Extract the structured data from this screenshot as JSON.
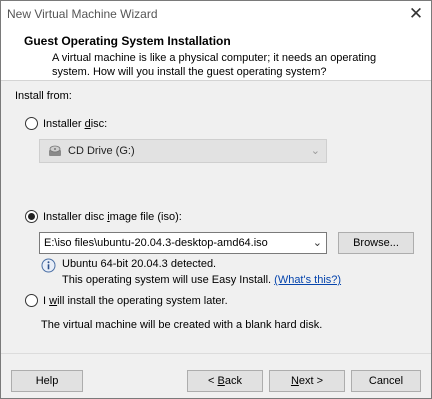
{
  "window": {
    "title": "New Virtual Machine Wizard",
    "close_glyph": "✕"
  },
  "header": {
    "title": "Guest Operating System Installation",
    "description": "A virtual machine is like a physical computer; it needs an operating system. How will you install the guest operating system?"
  },
  "install_from_label": "Install from:",
  "options": {
    "disc": {
      "label_pre": "Installer ",
      "label_acc": "d",
      "label_post": "isc:",
      "checked": false
    },
    "iso": {
      "label_pre": "Installer disc ",
      "label_acc": "i",
      "label_post": "mage file (iso):",
      "checked": true
    },
    "later": {
      "label_pre": "I ",
      "label_acc": "w",
      "label_post": "ill install the operating system later.",
      "checked": false
    }
  },
  "cd_drive": {
    "value": "CD Drive (G:)",
    "icon": "disc-drive-icon"
  },
  "iso_path": "E:\\iso files\\ubuntu-20.04.3-desktop-amd64.iso",
  "browse_button": "Browse...",
  "detection": {
    "line1": "Ubuntu 64-bit 20.04.3 detected.",
    "line2": "This operating system will use Easy Install.",
    "link": "(What's this?)",
    "icon": "info-icon"
  },
  "later_description": "The virtual machine will be created with a blank hard disk.",
  "footer": {
    "help": "Help",
    "back_pre": "< ",
    "back_acc": "B",
    "back_post": "ack",
    "next_pre": "",
    "next_acc": "N",
    "next_post": "ext >",
    "cancel": "Cancel"
  }
}
